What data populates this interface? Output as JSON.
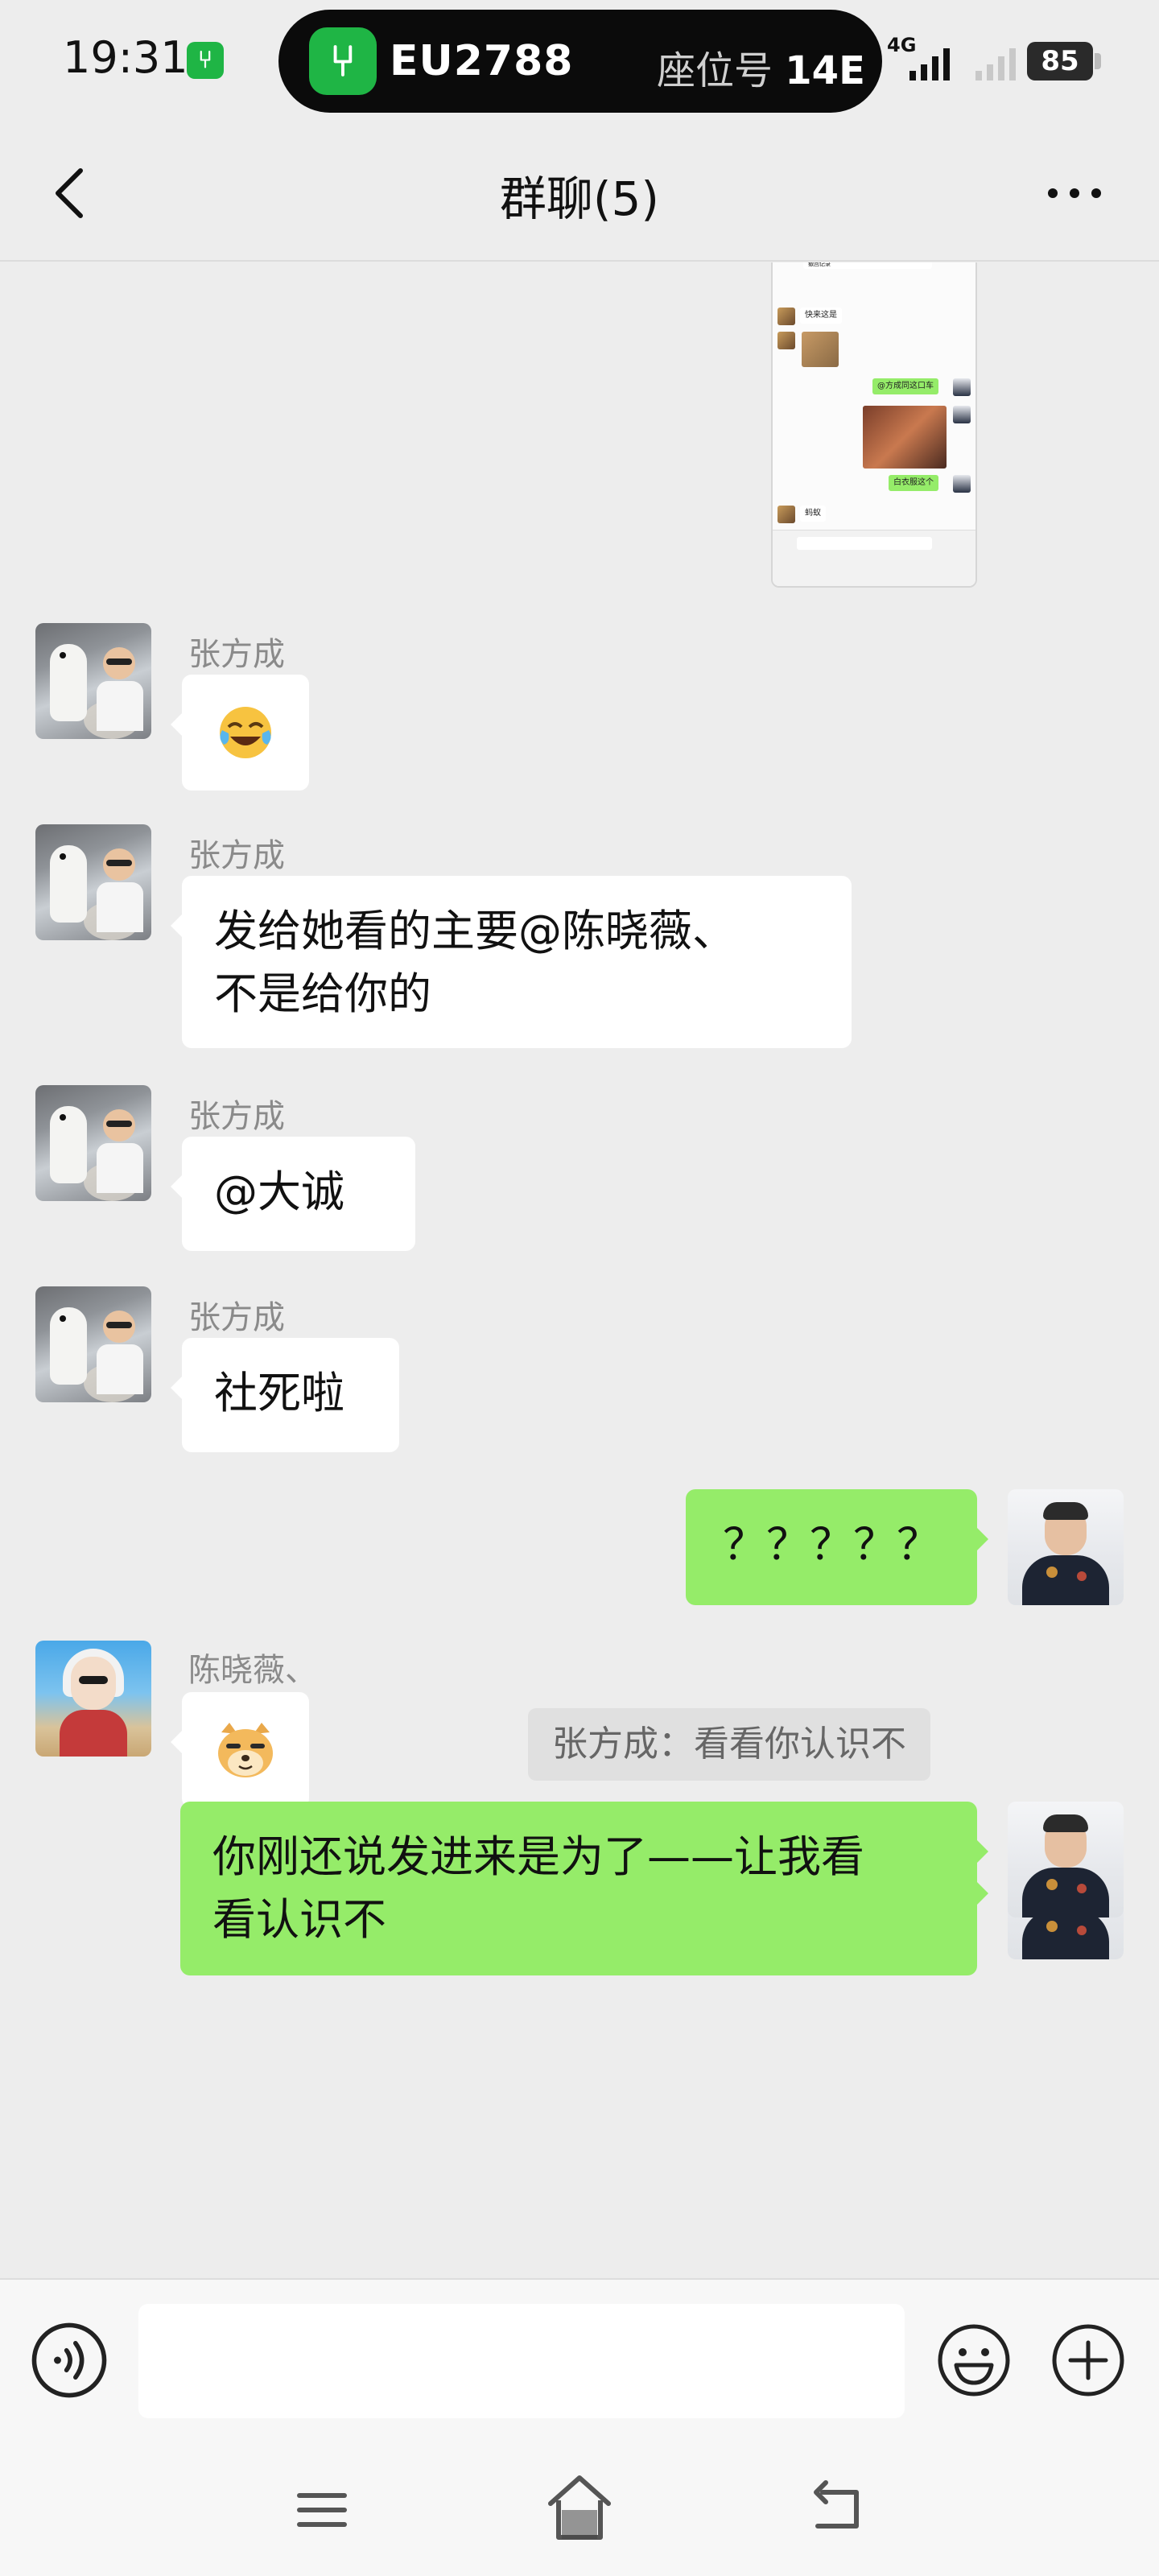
{
  "status_bar": {
    "time": "19:31",
    "flight": "EU2788",
    "seat_label": "座位号",
    "seat": "14E",
    "network": "4G",
    "battery": "85"
  },
  "header": {
    "title": "群聊(5)"
  },
  "screenshot_preview": {
    "labels": [
      "撤回记录",
      "快来这是",
      "@方成同这口车",
      "白衣服这个",
      "蚂蚁"
    ]
  },
  "messages": [
    {
      "sender": "张方成",
      "type": "emoji",
      "emoji": "face-with-tears-of-joy"
    },
    {
      "sender": "张方成",
      "type": "text",
      "lines": [
        "发给她看的主要@陈晓薇、",
        "不是给你的"
      ]
    },
    {
      "sender": "张方成",
      "type": "text",
      "lines": [
        "@大诚"
      ]
    },
    {
      "sender": "张方成",
      "type": "text",
      "lines": [
        "社死啦"
      ]
    },
    {
      "sender": "me",
      "type": "text",
      "lines": [
        "？？？？？"
      ]
    },
    {
      "sender": "陈晓薇、",
      "type": "emoji",
      "emoji": "doge-face"
    },
    {
      "sender": "me",
      "type": "text",
      "lines": [
        "？？？"
      ]
    },
    {
      "sender": "me",
      "type": "text",
      "lines": [
        "你刚还说发进来是为了——让我看",
        "看认识不"
      ]
    }
  ],
  "quote": "张方成：看看你认识不",
  "colors": {
    "sent_bubble": "#95ec69",
    "received_bubble": "#ffffff",
    "background": "#ededed",
    "brand_green": "#1fb545"
  }
}
